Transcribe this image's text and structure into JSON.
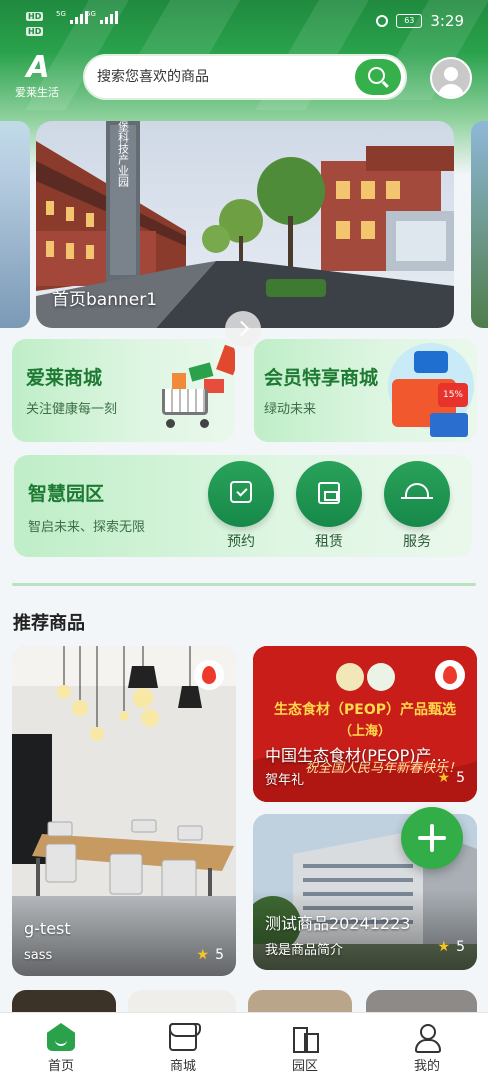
{
  "status_bar": {
    "left_badges": [
      "HD",
      "HD"
    ],
    "signals": [
      "5G",
      "5G"
    ],
    "battery": "63",
    "time": "3:29"
  },
  "header": {
    "logo_text": "爱莱生活",
    "search_placeholder": "搜索您喜欢的商品"
  },
  "banner": {
    "caption": "首页banner1",
    "building_sign": "爱登堡科技产业园"
  },
  "cards": {
    "mall": {
      "title": "爱莱商城",
      "subtitle": "关注健康每一刻"
    },
    "vip": {
      "title": "会员特享商城",
      "subtitle": "绿动未来",
      "badge": "15%"
    },
    "zone": {
      "title": "智慧园区",
      "subtitle": "智启未来、探索无限",
      "buttons": [
        "预约",
        "租赁",
        "服务"
      ]
    }
  },
  "section_title": "推荐商品",
  "products": [
    {
      "name": "g-test",
      "desc": "sass",
      "rating": "5"
    },
    {
      "name": "中国生态食材(PEOP)产...",
      "desc": "贺年礼",
      "rating": "5",
      "poster_line1": "生态食材（PEOP）产品甄选",
      "poster_line2": "（上海）",
      "poster_line3": "祝全国人民马年新春快乐！"
    },
    {
      "name": "测试商品20241223",
      "desc": "我是商品简介",
      "rating": "5"
    }
  ],
  "tabbar": {
    "items": [
      "首页",
      "商城",
      "园区",
      "我的"
    ],
    "active": "首页"
  },
  "colors": {
    "brand": "#2aa24c",
    "star": "#f6c522",
    "hot": "#ee3a2c"
  }
}
